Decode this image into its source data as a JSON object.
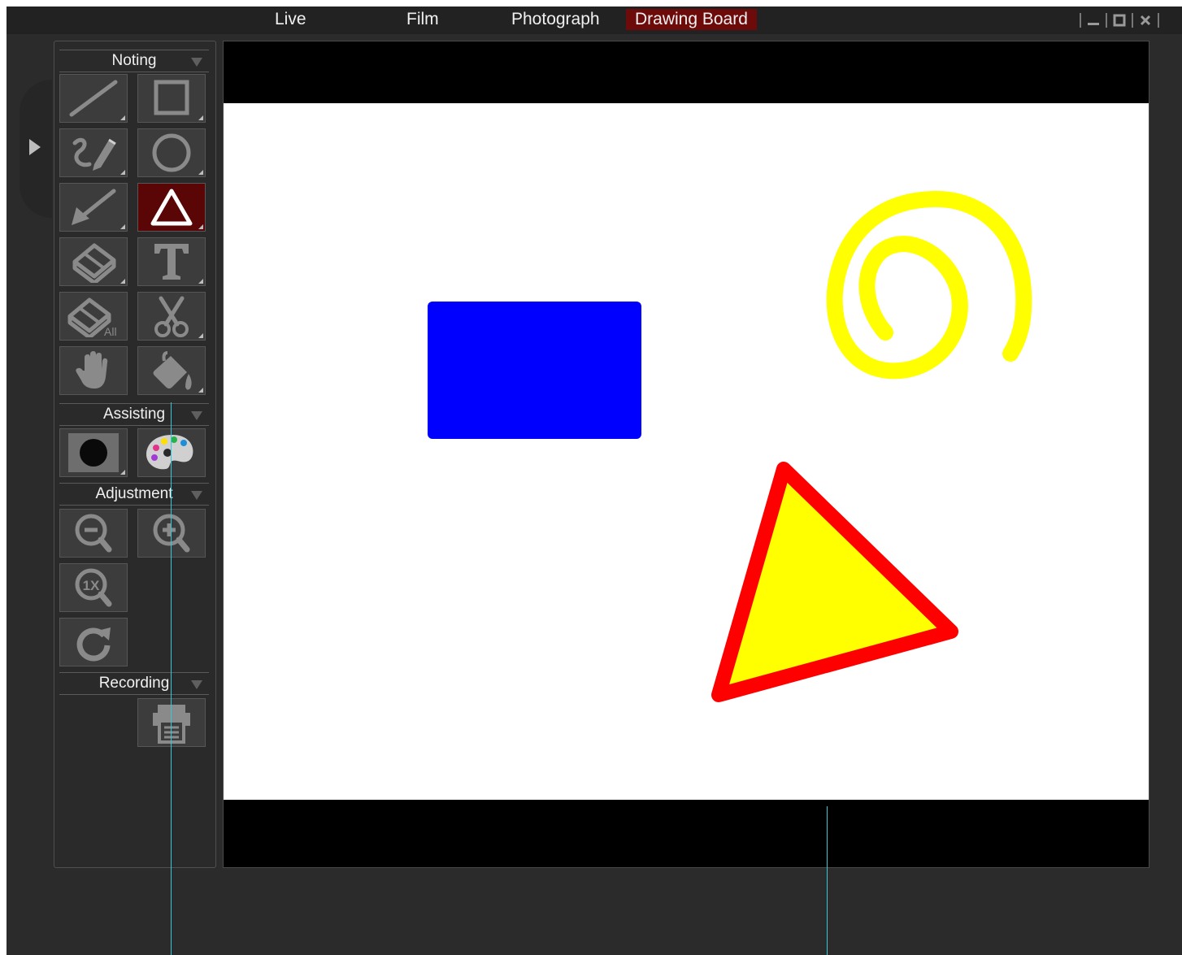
{
  "menu": {
    "items": [
      {
        "label": "Live",
        "active": false
      },
      {
        "label": "Film",
        "active": false
      },
      {
        "label": "Photograph",
        "active": false
      },
      {
        "label": "Drawing Board",
        "active": true
      }
    ],
    "active_color": "#6d0a0a"
  },
  "window_controls": {
    "icons": [
      "minimize-icon",
      "maximize-icon",
      "close-icon"
    ]
  },
  "panel": {
    "sections": [
      {
        "title": "Noting"
      },
      {
        "title": "Assisting"
      },
      {
        "title": "Adjustment"
      },
      {
        "title": "Recording"
      }
    ],
    "noting_tools": [
      "line-icon",
      "rectangle-icon",
      "freehand-pen-icon",
      "circle-icon",
      "arrow-icon",
      "triangle-icon",
      "eraser-icon",
      "text-icon",
      "erase-all-icon",
      "scissors-icon",
      "hand-icon",
      "fill-bucket-icon"
    ],
    "eraser_all_label": "All",
    "active_tool": "triangle-icon",
    "assisting_tools": [
      "spotlight-icon",
      "palette-icon"
    ],
    "adjustment_tools": [
      "zoom-out-icon",
      "zoom-in-icon",
      "zoom-1x-icon",
      "rotate-icon"
    ],
    "zoom_1x_label": "1X",
    "recording_tools": [
      "print-icon"
    ]
  },
  "canvas": {
    "shapes": [
      {
        "type": "rectangle",
        "fill": "#0000ff"
      },
      {
        "type": "spiral",
        "stroke": "#ffff00"
      },
      {
        "type": "triangle",
        "fill": "#ffff00",
        "stroke": "#ff0000"
      }
    ]
  }
}
